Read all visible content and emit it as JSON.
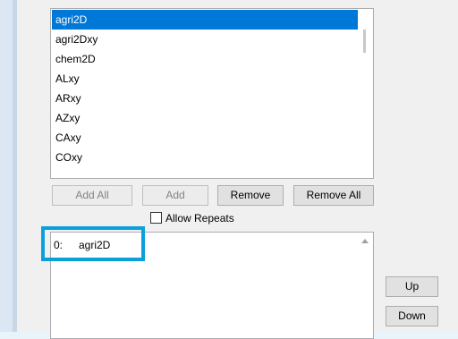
{
  "source_list": {
    "items": [
      "agri2D",
      "agri2Dxy",
      "chem2D",
      "ALxy",
      "ARxy",
      "AZxy",
      "CAxy",
      "COxy"
    ],
    "selected_index": 0
  },
  "buttons": {
    "add_all": "Add All",
    "add": "Add",
    "remove": "Remove",
    "remove_all": "Remove All",
    "up": "Up",
    "down": "Down"
  },
  "allow_repeats": {
    "label": "Allow Repeats",
    "checked": false
  },
  "target_list": {
    "items": [
      {
        "index": "0:",
        "name": "agri2D"
      }
    ]
  },
  "colors": {
    "selection": "#0078d7",
    "highlight": "#0aa0dc"
  }
}
